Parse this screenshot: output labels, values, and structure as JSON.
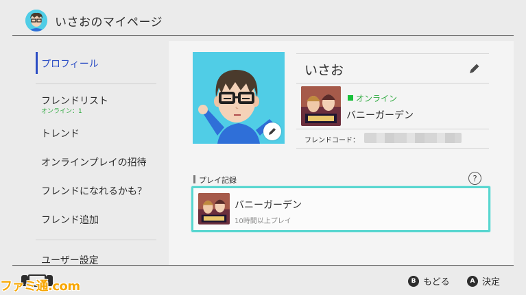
{
  "header": {
    "title": "いさおのマイページ",
    "avatar_icon": "user-avatar-icon"
  },
  "sidebar": {
    "items": [
      {
        "label": "プロフィール",
        "active": true
      },
      {
        "label": "フレンドリスト",
        "sub": "オンライン：1"
      },
      {
        "label": "トレンド"
      },
      {
        "label": "オンラインプレイの招待"
      },
      {
        "label": "フレンドになれるかも？"
      },
      {
        "label": "フレンド追加"
      },
      {
        "label": "ユーザー設定"
      }
    ]
  },
  "profile": {
    "username": "いさお",
    "status": "オンライン",
    "current_game": "バニーガーデン",
    "friend_code_label": "フレンドコード："
  },
  "play_record": {
    "title": "プレイ記録",
    "help": "?",
    "entries": [
      {
        "game": "バニーガーデン",
        "time": "10時間以上プレイ"
      }
    ]
  },
  "footer": {
    "back_key": "B",
    "back_label": "もどる",
    "ok_key": "A",
    "ok_label": "決定"
  },
  "watermark": "ファミ通.com",
  "colors": {
    "accent_blue": "#2b4dc4",
    "online_green": "#18c03a",
    "selection_cyan": "#5ad7d0",
    "avatar_bg": "#50cde6"
  }
}
